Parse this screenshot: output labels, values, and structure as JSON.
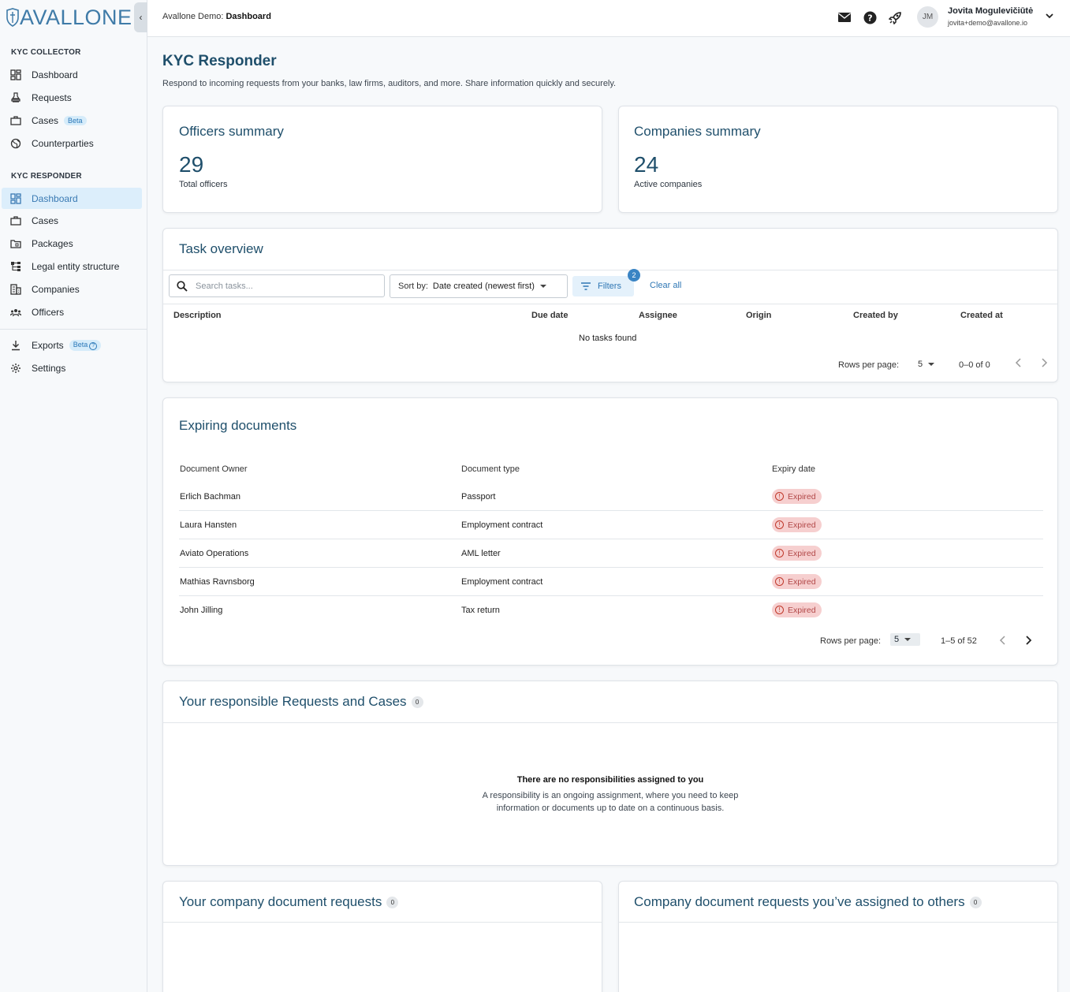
{
  "brand": "AVALLONE",
  "sidebar": {
    "collector_title": "KYC COLLECTOR",
    "collector_items": [
      {
        "label": "Dashboard"
      },
      {
        "label": "Requests"
      },
      {
        "label": "Cases",
        "badge": "Beta"
      },
      {
        "label": "Counterparties"
      }
    ],
    "responder_title": "KYC RESPONDER",
    "responder_items": [
      {
        "label": "Dashboard"
      },
      {
        "label": "Cases"
      },
      {
        "label": "Packages"
      },
      {
        "label": "Legal entity structure"
      },
      {
        "label": "Companies"
      },
      {
        "label": "Officers"
      }
    ],
    "bottom_items": [
      {
        "label": "Exports",
        "badge": "Beta"
      },
      {
        "label": "Settings"
      }
    ]
  },
  "header": {
    "org": "Avallone Demo:",
    "page": "Dashboard",
    "avatar_initials": "JM",
    "user_name": "Jovita Mogulevičiūtė",
    "user_email": "jovita+demo@avallone.io"
  },
  "page": {
    "title": "KYC Responder",
    "subtitle": "Respond to incoming requests from your banks, law firms, auditors, and more. Share information quickly and securely."
  },
  "officers": {
    "title": "Officers summary",
    "value": "29",
    "label": "Total officers"
  },
  "companies": {
    "title": "Companies summary",
    "value": "24",
    "label": "Active companies"
  },
  "tasks": {
    "title": "Task overview",
    "search_placeholder": "Search tasks...",
    "sort_label": "Sort by:",
    "sort_value": "Date created (newest first)",
    "filters_label": "Filters",
    "filters_count": "2",
    "clear_label": "Clear all",
    "columns": [
      "Description",
      "Due date",
      "Assignee",
      "Origin",
      "Created by",
      "Created at"
    ],
    "empty": "No tasks found",
    "rows_per_page_label": "Rows per page:",
    "rows_per_page": "5",
    "range": "0–0 of 0"
  },
  "expiring": {
    "title": "Expiring documents",
    "columns": [
      "Document Owner",
      "Document type",
      "Expiry date"
    ],
    "rows": [
      {
        "owner": "Erlich Bachman",
        "type": "Passport",
        "status": "Expired"
      },
      {
        "owner": "Laura Hansten",
        "type": "Employment contract",
        "status": "Expired"
      },
      {
        "owner": "Aviato Operations",
        "type": "AML letter",
        "status": "Expired"
      },
      {
        "owner": "Mathias Ravnsborg",
        "type": "Employment contract",
        "status": "Expired"
      },
      {
        "owner": "John Jilling",
        "type": "Tax return",
        "status": "Expired"
      }
    ],
    "rows_per_page_label": "Rows per page:",
    "rows_per_page": "5",
    "range": "1–5 of 52"
  },
  "responsible": {
    "title": "Your responsible Requests and Cases",
    "count": "0",
    "empty_title": "There are no responsibilities assigned to you",
    "empty_line1": "A responsibility is an ongoing assignment, where you need to keep",
    "empty_line2": "information or documents up to date on a continuous basis."
  },
  "company_requests": {
    "title": "Your company document requests",
    "count": "0"
  },
  "assigned_others": {
    "title": "Company document requests you’ve assigned to others",
    "count": "0"
  },
  "colors": {
    "accent": "#3a7ab3",
    "title": "#1f4f6b",
    "expired_bg": "#f6cfcf",
    "expired_fg": "#b24848"
  }
}
